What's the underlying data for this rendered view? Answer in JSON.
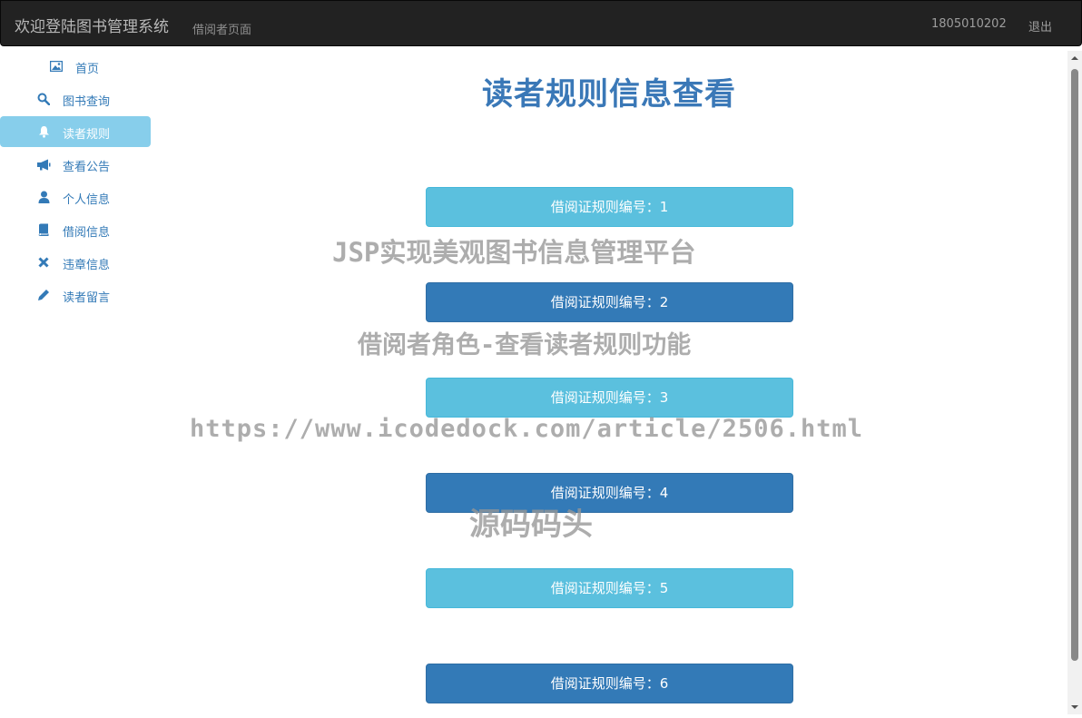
{
  "header": {
    "brand": "欢迎登陆图书管理系统",
    "subtitle": "借阅者页面",
    "user_id": "1805010202",
    "logout_label": "退出"
  },
  "sidebar": {
    "items": [
      {
        "label": "首页",
        "icon": "picture-icon"
      },
      {
        "label": "图书查询",
        "icon": "search-icon"
      },
      {
        "label": "读者规则",
        "icon": "bell-icon",
        "active": true
      },
      {
        "label": "查看公告",
        "icon": "bullhorn-icon"
      },
      {
        "label": "个人信息",
        "icon": "user-icon"
      },
      {
        "label": "借阅信息",
        "icon": "book-icon"
      },
      {
        "label": "违章信息",
        "icon": "close-icon"
      },
      {
        "label": "读者留言",
        "icon": "pencil-icon"
      }
    ]
  },
  "main": {
    "title": "读者规则信息查看",
    "rules": [
      {
        "label": "借阅证规则编号：1"
      },
      {
        "label": "借阅证规则编号：2"
      },
      {
        "label": "借阅证规则编号：3"
      },
      {
        "label": "借阅证规则编号：4"
      },
      {
        "label": "借阅证规则编号：5"
      },
      {
        "label": "借阅证规则编号：6"
      }
    ]
  },
  "watermarks": {
    "line1": "JSP实现美观图书信息管理平台",
    "line2": "借阅者角色-查看读者规则功能",
    "line3": "https://www.icodedock.com/article/2506.html",
    "line4": "源码码头"
  },
  "colors": {
    "navbar": "#222222",
    "link": "#337ab7",
    "active_bg": "#87ceeb",
    "btn_info": "#5bc0de",
    "btn_primary": "#337ab7"
  }
}
